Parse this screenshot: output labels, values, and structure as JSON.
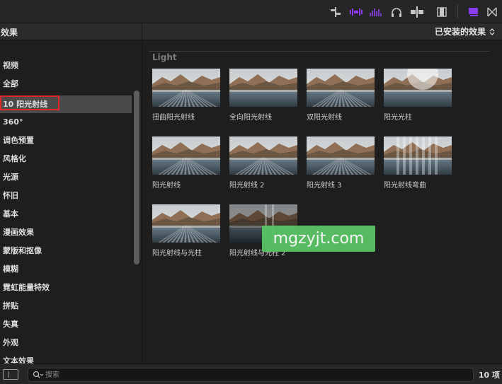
{
  "header": {
    "title": "效果",
    "installed_label": "已安装的效果"
  },
  "sidebar": {
    "items": [
      {
        "label": "视频"
      },
      {
        "label": "全部"
      },
      {
        "label": "10 阳光射线"
      },
      {
        "label": "360°"
      },
      {
        "label": "调色预置"
      },
      {
        "label": "风格化"
      },
      {
        "label": "光源"
      },
      {
        "label": "怀旧"
      },
      {
        "label": "基本"
      },
      {
        "label": "漫画效果"
      },
      {
        "label": "蒙版和抠像"
      },
      {
        "label": "模糊"
      },
      {
        "label": "霓虹能量特效"
      },
      {
        "label": "拼贴"
      },
      {
        "label": "失真"
      },
      {
        "label": "外观"
      },
      {
        "label": "文本效果"
      }
    ],
    "selected_index": 2
  },
  "main": {
    "section_title": "Light",
    "effects": [
      {
        "label": "扭曲阳光射线",
        "style": "rays"
      },
      {
        "label": "全向阳光射线",
        "style": "plain"
      },
      {
        "label": "双阳光射线",
        "style": "rays"
      },
      {
        "label": "阳光光柱",
        "style": "glow"
      },
      {
        "label": "阳光射线",
        "style": "rays"
      },
      {
        "label": "阳光射线 2",
        "style": "rays"
      },
      {
        "label": "阳光射线 3",
        "style": "rays"
      },
      {
        "label": "阳光射线弯曲",
        "style": "bands"
      },
      {
        "label": "阳光射线与光柱",
        "style": "rays"
      },
      {
        "label": "阳光射线与光柱 2",
        "style": "dark"
      }
    ]
  },
  "watermark": "mgzyjt.com",
  "search": {
    "placeholder": "搜索",
    "value": ""
  },
  "status": {
    "count": "10 项"
  },
  "colors": {
    "accent_purple": "#8a3cf0",
    "selection_outline": "#e0282a",
    "watermark_green": "#59c465"
  }
}
